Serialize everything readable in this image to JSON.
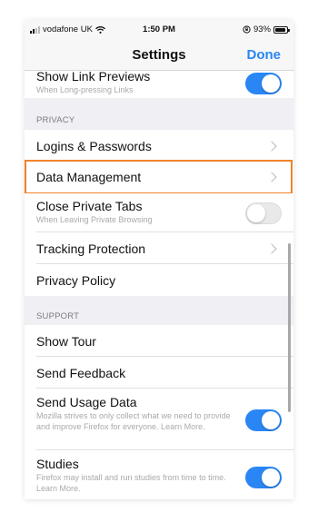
{
  "status_bar": {
    "carrier": "vodafone UK",
    "time": "1:50 PM",
    "battery": "93%",
    "battery_level": 0.93
  },
  "nav": {
    "title": "Settings",
    "done_label": "Done"
  },
  "rows": {
    "show_link_previews": {
      "label": "Show Link Previews",
      "sub": "When Long-pressing Links",
      "toggle": true
    },
    "logins": {
      "label": "Logins & Passwords"
    },
    "data_management": {
      "label": "Data Management"
    },
    "close_private_tabs": {
      "label": "Close Private Tabs",
      "sub": "When Leaving Private Browsing",
      "toggle": false
    },
    "tracking_protection": {
      "label": "Tracking Protection"
    },
    "privacy_policy": {
      "label": "Privacy Policy"
    },
    "show_tour": {
      "label": "Show Tour"
    },
    "send_feedback": {
      "label": "Send Feedback"
    },
    "send_usage_data": {
      "label": "Send Usage Data",
      "sub": "Mozilla strives to only collect what we need to provide and improve Firefox for everyone. Learn More.",
      "toggle": true
    },
    "studies": {
      "label": "Studies",
      "sub": "Firefox may install and run studies from time to time. Learn More.",
      "toggle": true
    }
  },
  "sections": {
    "privacy": "PRIVACY",
    "support": "SUPPORT"
  },
  "colors": {
    "accent": "#2a86f5",
    "highlight": "#f0832a",
    "background": "#efeff4"
  },
  "icons": [
    "signal-icon",
    "wifi-icon",
    "orientation-lock-icon",
    "battery-icon",
    "chevron-right-icon"
  ]
}
